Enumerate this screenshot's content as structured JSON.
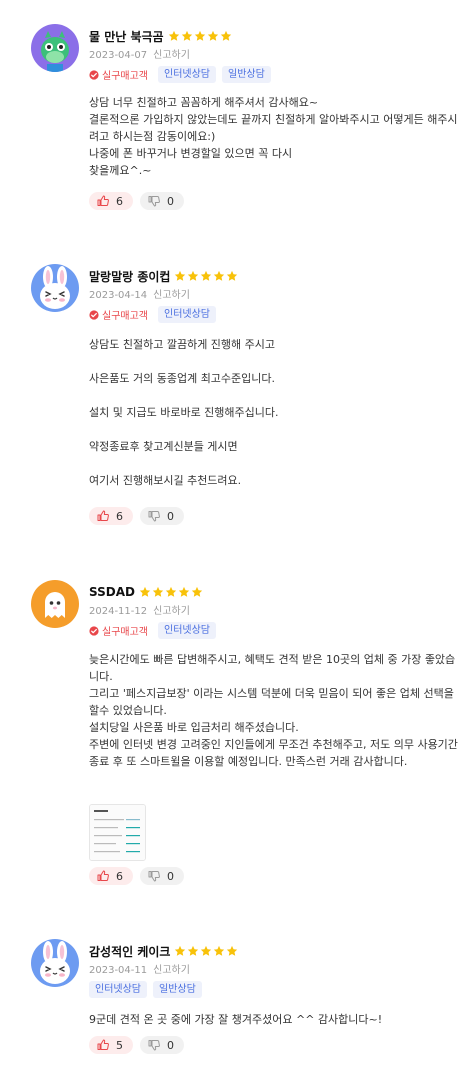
{
  "colors": {
    "star": "#f8c20a",
    "verified": "#e8464a",
    "tag_text": "#4a6fe0",
    "tag_bg": "#eef1fb",
    "like_bg": "#fdecec",
    "dislike_bg": "#f1f1f1"
  },
  "reviews": [
    {
      "name": "물 만난 북극곰",
      "rating": 5,
      "date": "2023-04-07",
      "report": "신고하기",
      "verified": "실구매고객",
      "tags": [
        "인터넷상담",
        "일반상담"
      ],
      "body": "상담 너무 친절하고 꼼꼼하게 해주셔서 감사해요~\n결론적으론 가입하지 않았는데도 끝까지 친절하게 알아봐주시고 어떻게든 해주시려고 하시는점 감동이에요:)\n나중에 폰 바꾸거나 변경할일 있으면 꼭 다시\n찾을께요^.~",
      "likes": "6",
      "dislikes": "0",
      "avatar": "green-dragon-avatar"
    },
    {
      "name": "말랑말랑 종이컵",
      "rating": 5,
      "date": "2023-04-14",
      "report": "신고하기",
      "verified": "실구매고객",
      "tags": [
        "인터넷상담"
      ],
      "body": "상담도 친절하고 깔끔하게 진행해 주시고\n\n사은품도 거의 동종업계 최고수준입니다.\n\n설치 및 지급도 바로바로 진행해주십니다.\n\n약정종료후 찾고계신분들 게시면\n\n여기서 진행해보시길 추천드려요.",
      "likes": "6",
      "dislikes": "0",
      "avatar": "bunny-avatar"
    },
    {
      "name": "SSDAD",
      "rating": 5,
      "date": "2024-11-12",
      "report": "신고하기",
      "verified": "실구매고객",
      "tags": [
        "인터넷상담"
      ],
      "body": "늦은시간에도 빠른 답변해주시고, 혜택도 견적 받은 10곳의 업체 중 가장 좋았습니다.\n그리고 '페스지급보장' 이라는 시스템 덕분에 더욱 믿음이 되어 좋은 업체 선택을 할수 있었습니다.\n설치당일 사은품 바로 입금처리 해주셨습니다.\n주변에 인터넷 변경 고려중인 지인들에게 무조건 추천해주고, 저도 의무 사용기간 종료 후 또 스마트윌을 이용할 예정입니다. 만족스런 거래 감사합니다.",
      "likes": "6",
      "dislikes": "0",
      "avatar": "ghost-avatar",
      "has_photo": true
    },
    {
      "name": "감성적인 케이크",
      "rating": 5,
      "date": "2023-04-11",
      "report": "신고하기",
      "tags": [
        "인터넷상담",
        "일반상담"
      ],
      "body": "9군데 견적 온 곳 중에 가장 잘 챙겨주셨어요 ^^ 감사합니다~!",
      "likes": "5",
      "dislikes": "0",
      "avatar": "bunny-avatar"
    }
  ]
}
